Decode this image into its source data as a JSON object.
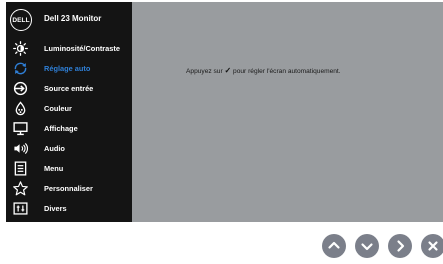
{
  "header": {
    "logo_text": "DELL",
    "title": "Dell 23 Monitor"
  },
  "menu": {
    "items": [
      {
        "label": "Luminosité/Contraste",
        "icon": "brightness-icon"
      },
      {
        "label": "Réglage auto",
        "icon": "auto-adjust-icon",
        "active": true
      },
      {
        "label": "Source entrée",
        "icon": "input-source-icon"
      },
      {
        "label": "Couleur",
        "icon": "color-icon"
      },
      {
        "label": "Affichage",
        "icon": "display-icon"
      },
      {
        "label": "Audio",
        "icon": "audio-icon"
      },
      {
        "label": "Menu",
        "icon": "menu-icon"
      },
      {
        "label": "Personnaliser",
        "icon": "star-icon"
      },
      {
        "label": "Divers",
        "icon": "others-icon"
      }
    ]
  },
  "content": {
    "message_before": "Appuyez sur",
    "check_glyph": "✓",
    "message_after": "pour régler l'écran automatiquement."
  },
  "buttons": [
    {
      "name": "up-button",
      "icon": "chevron-up-icon"
    },
    {
      "name": "down-button",
      "icon": "chevron-down-icon"
    },
    {
      "name": "right-button",
      "icon": "chevron-right-icon"
    },
    {
      "name": "close-button",
      "icon": "close-icon"
    }
  ],
  "colors": {
    "sidebar_bg": "#141414",
    "content_bg": "#999c9f",
    "active_text": "#2f7fd6",
    "button_bg": "#7b7f8a"
  }
}
